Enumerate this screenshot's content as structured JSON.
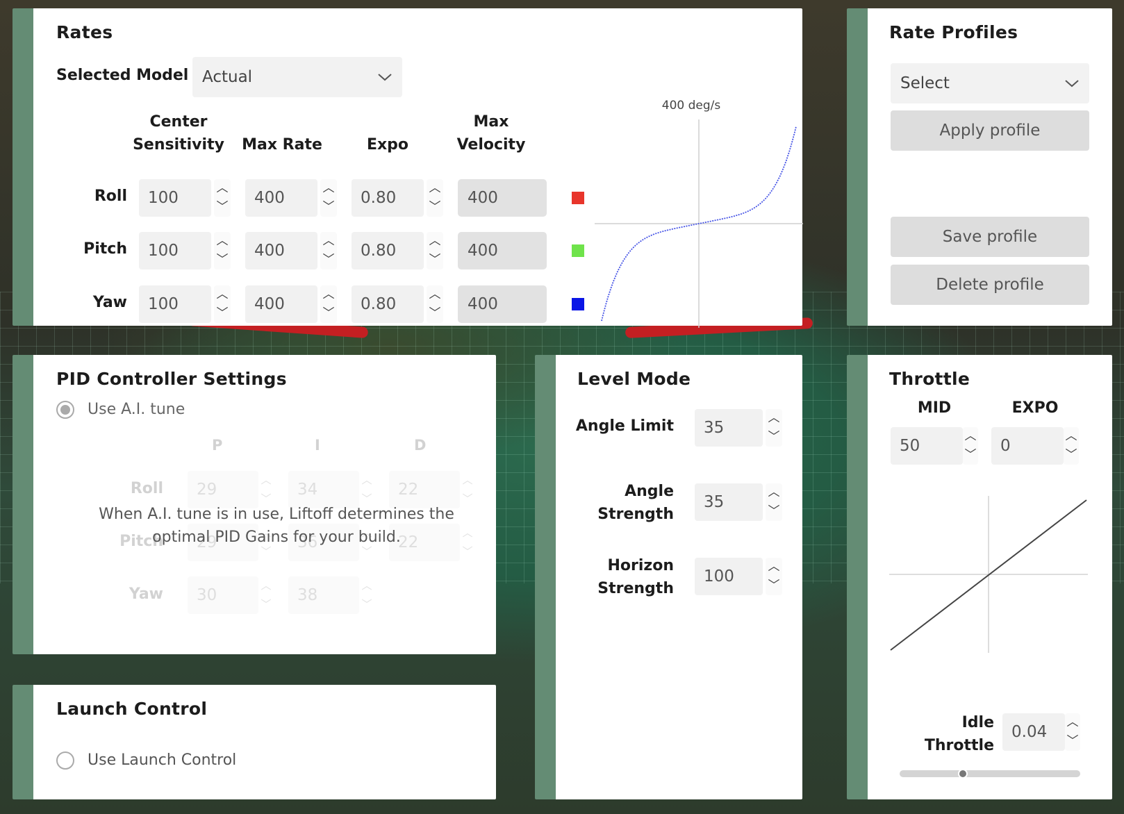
{
  "colors": {
    "accent_bar": "#648c74",
    "roll": "#e8352b",
    "pitch": "#6fe34b",
    "yaw": "#0a16e6",
    "curve": "#4654e6"
  },
  "rates": {
    "title": "Rates",
    "selected_model_label": "Selected Model",
    "selected_model_value": "Actual",
    "columns": {
      "center_sensitivity": "Center Sensitivity",
      "max_rate": "Max Rate",
      "expo": "Expo",
      "max_velocity": "Max Velocity"
    },
    "rows": [
      {
        "axis": "Roll",
        "center": "100",
        "max_rate": "400",
        "expo": "0.80",
        "max_velocity": "400"
      },
      {
        "axis": "Pitch",
        "center": "100",
        "max_rate": "400",
        "expo": "0.80",
        "max_velocity": "400"
      },
      {
        "axis": "Yaw",
        "center": "100",
        "max_rate": "400",
        "expo": "0.80",
        "max_velocity": "400"
      }
    ],
    "graph_label": "400 deg/s"
  },
  "rate_profiles": {
    "title": "Rate Profiles",
    "select_value": "Select",
    "apply": "Apply profile",
    "save": "Save profile",
    "delete": "Delete profile"
  },
  "pid": {
    "title": "PID Controller Settings",
    "use_ai_tune": "Use A.I. tune",
    "headers": [
      "P",
      "I",
      "D"
    ],
    "rows": [
      {
        "axis": "Roll",
        "p": "29",
        "i": "34",
        "d": "22"
      },
      {
        "axis": "Pitch",
        "p": "29",
        "i": "36",
        "d": "22"
      },
      {
        "axis": "Yaw",
        "p": "30",
        "i": "38"
      }
    ],
    "ai_note": "When A.I. tune is in use, Liftoff determines the optimal PID Gains for your build."
  },
  "launch": {
    "title": "Launch Control",
    "option": "Use Launch Control"
  },
  "level": {
    "title": "Level Mode",
    "angle_limit_label": "Angle Limit",
    "angle_limit": "35",
    "angle_strength_label": "Angle Strength",
    "angle_strength": "35",
    "horizon_strength_label": "Horizon Strength",
    "horizon_strength": "100"
  },
  "throttle": {
    "title": "Throttle",
    "mid_label": "MID",
    "mid": "50",
    "expo_label": "EXPO",
    "expo": "0",
    "idle_label": "Idle Throttle",
    "idle": "0.04",
    "idle_slider_fraction": 0.35
  }
}
